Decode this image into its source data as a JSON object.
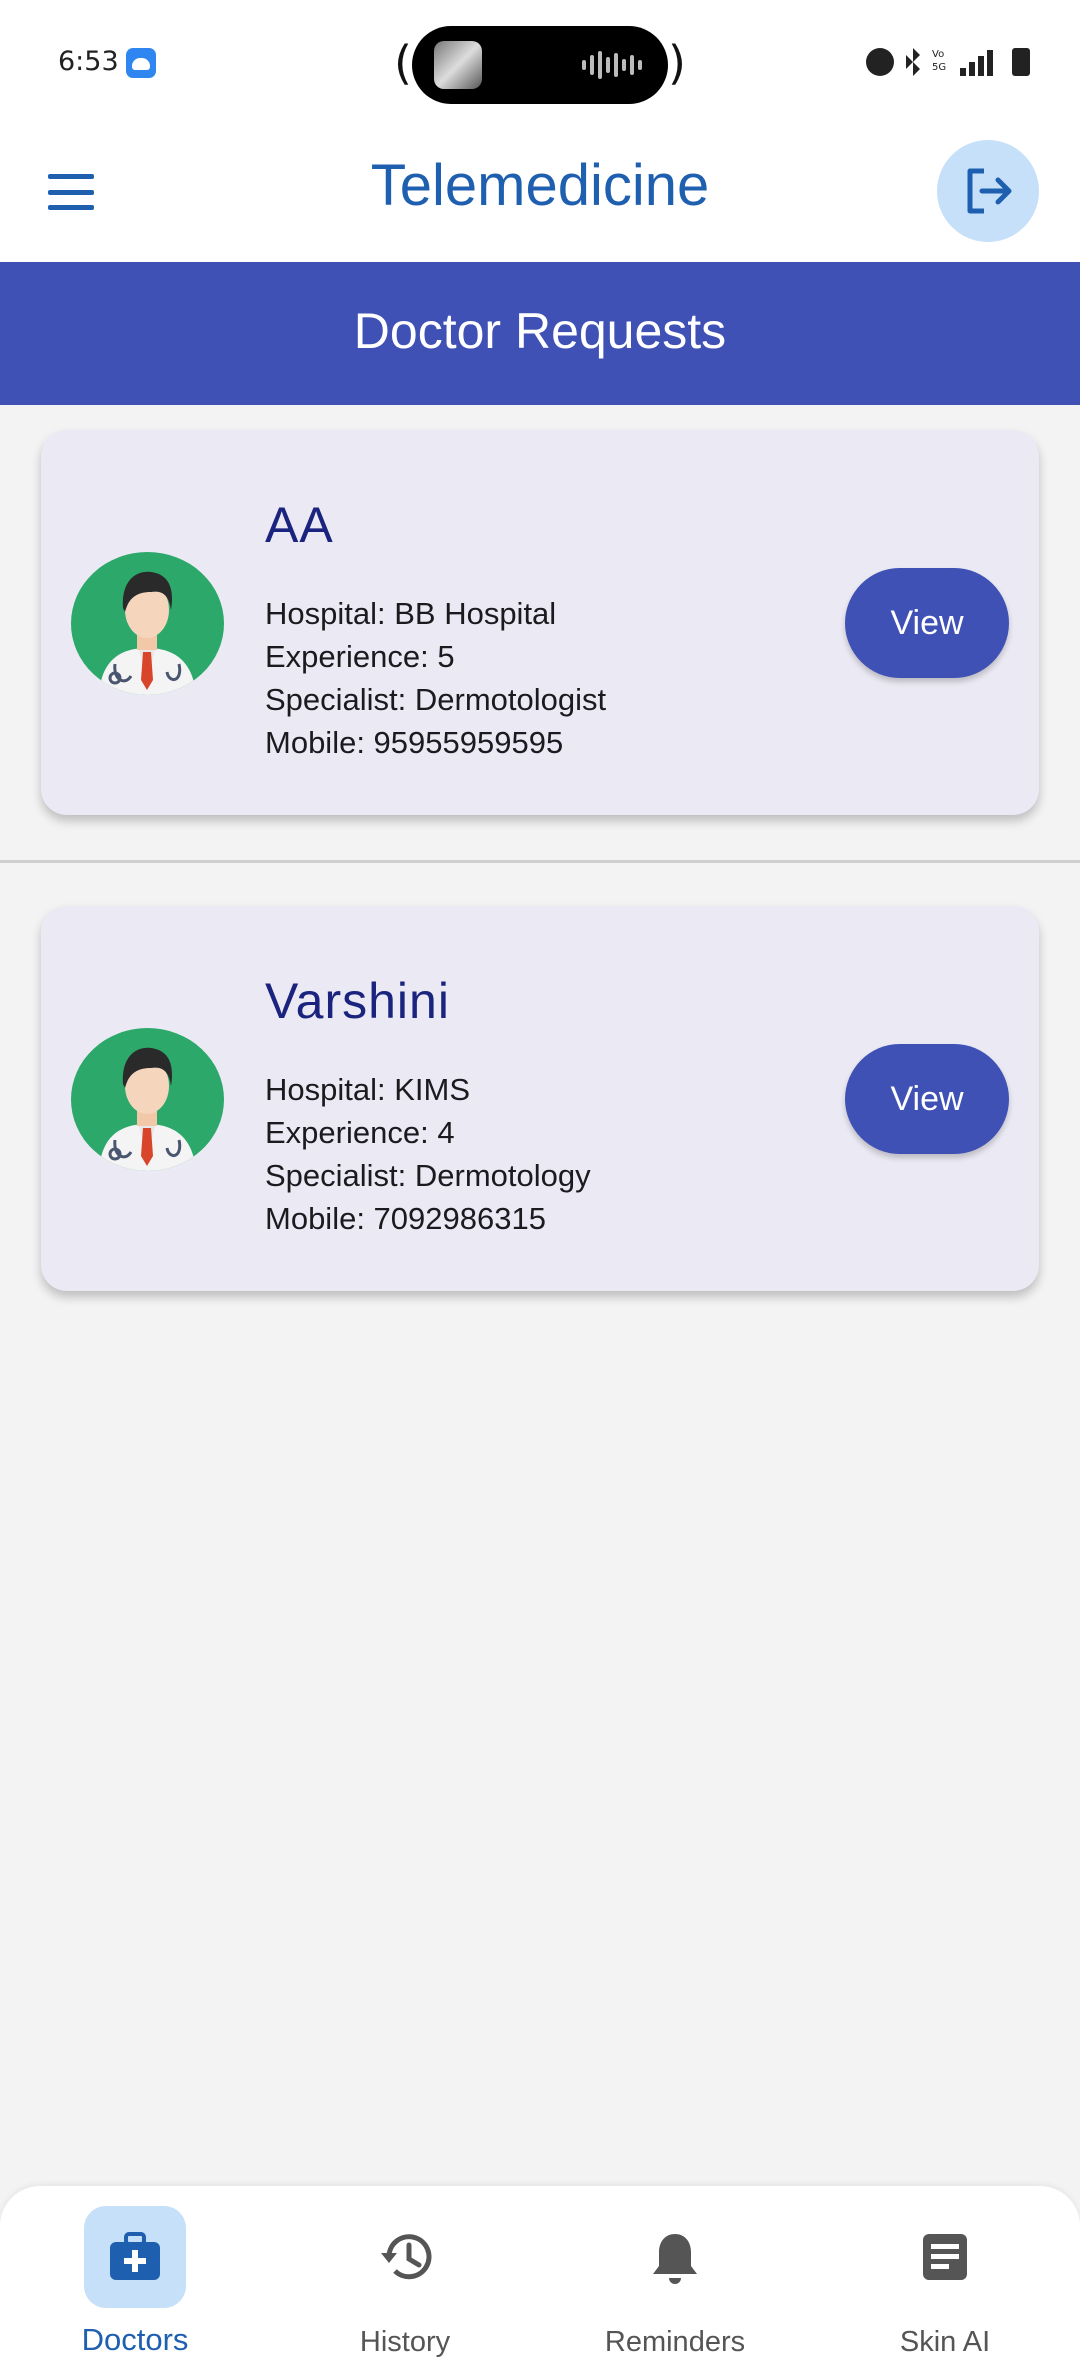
{
  "status_bar": {
    "time": "6:53",
    "icons": [
      "android-notification-icon",
      "alarm-icon",
      "bluetooth-icon",
      "volte-icon",
      "5g-signal-icon",
      "battery-icon"
    ]
  },
  "app_bar": {
    "title": "Telemedicine",
    "menu_icon": "menu-icon",
    "logout_icon": "logout-icon"
  },
  "header": {
    "title": "Doctor Requests",
    "background": "#3f51b5"
  },
  "doctors": [
    {
      "name": "AA",
      "hospital": "Hospital: BB Hospital",
      "experience": "Experience: 5",
      "specialist": "Specialist: Dermotologist",
      "mobile": "Mobile: 95955959595",
      "button": "View"
    },
    {
      "name": "Varshini",
      "hospital": "Hospital: KIMS",
      "experience": "Experience: 4",
      "specialist": "Specialist: Dermotology",
      "mobile": "Mobile: 7092986315",
      "button": "View"
    }
  ],
  "bottom_nav": {
    "active": "Doctors",
    "items": [
      {
        "label": "Doctors",
        "icon": "medical-bag-icon"
      },
      {
        "label": "History",
        "icon": "history-icon"
      },
      {
        "label": "Reminders",
        "icon": "bell-icon"
      },
      {
        "label": "Skin AI",
        "icon": "document-icon"
      }
    ]
  },
  "colors": {
    "primary": "#3f51b5",
    "accent_text": "#1f5fb0",
    "card_bg": "#ebe9f3",
    "active_nav_bg": "#c5e0f8"
  }
}
